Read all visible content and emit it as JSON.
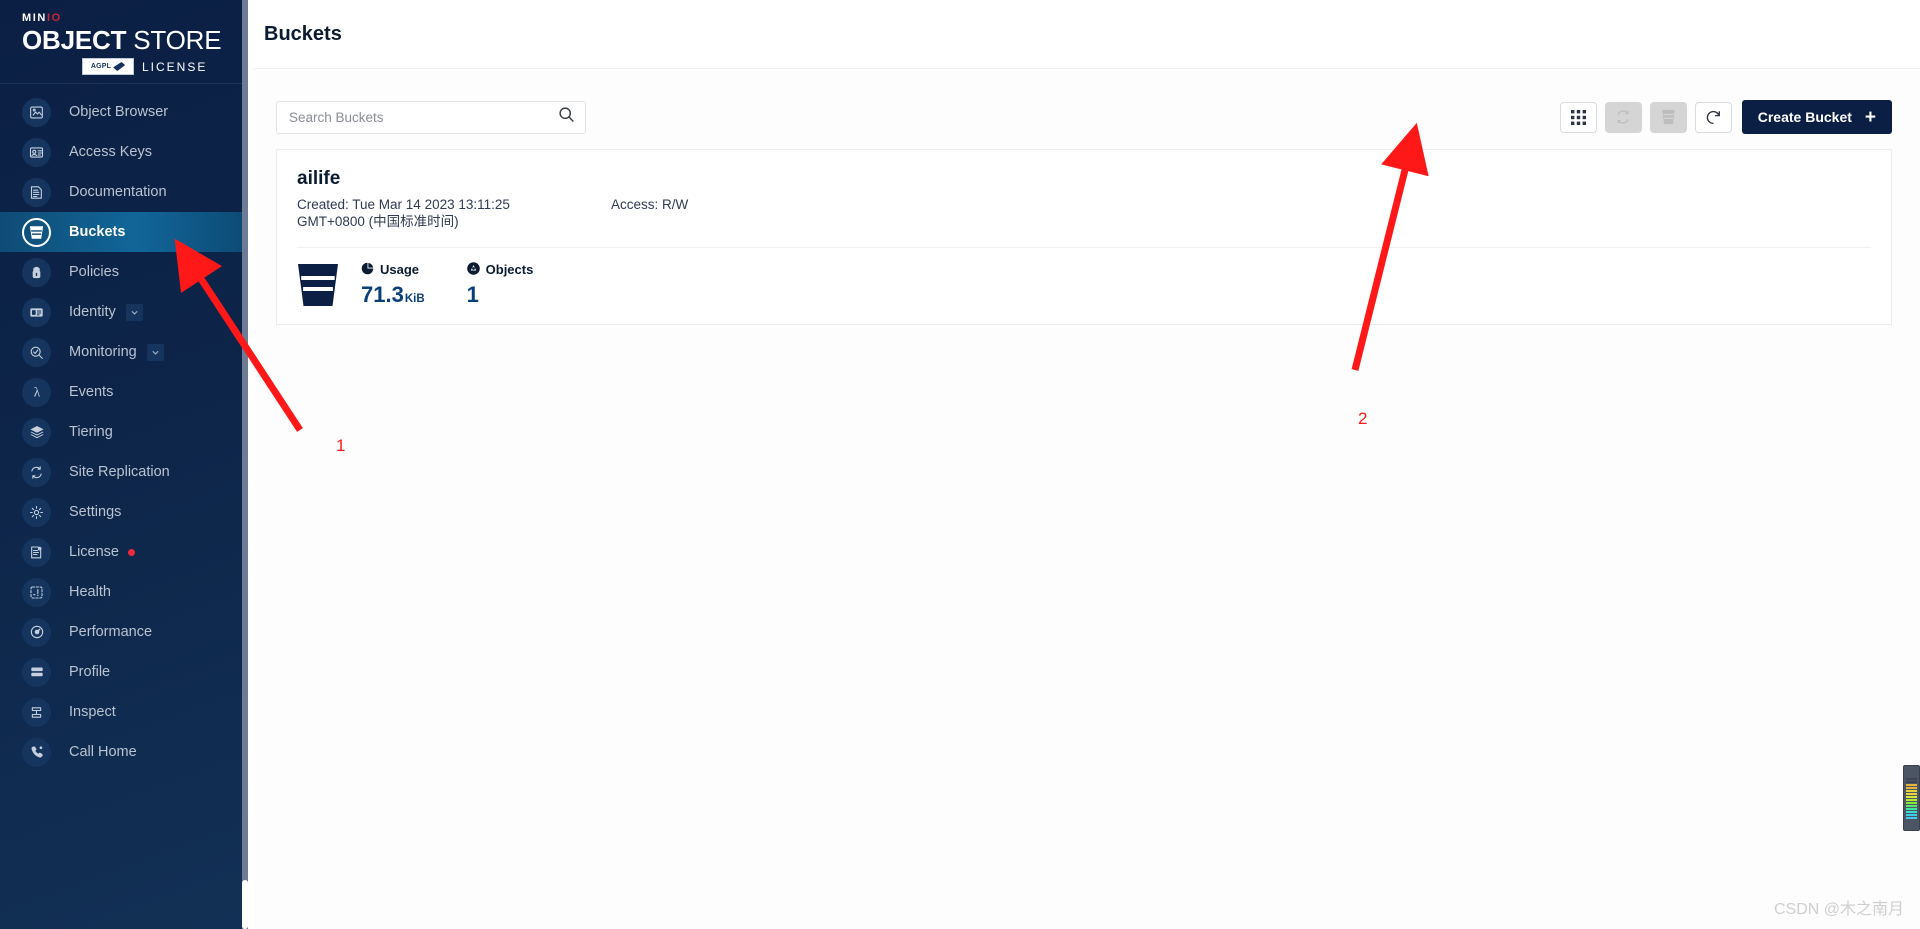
{
  "brand": {
    "line1_prefix": "MIN",
    "line1_suffix": "IO",
    "line2_bold": "OBJECT",
    "line2_thin": " STORE",
    "badge_text": "AGPL",
    "license_text": "LICENSE",
    "brand_red": "#c42a32",
    "sidebar_bg": "#0b1f44"
  },
  "sidebar": {
    "items": [
      {
        "label": "Object Browser",
        "icon": "object-browser-icon",
        "active": false
      },
      {
        "label": "Access Keys",
        "icon": "access-keys-icon",
        "active": false
      },
      {
        "label": "Documentation",
        "icon": "documentation-icon",
        "active": false
      },
      {
        "label": "Buckets",
        "icon": "bucket-icon",
        "active": true
      },
      {
        "label": "Policies",
        "icon": "policies-icon",
        "active": false
      },
      {
        "label": "Identity",
        "icon": "identity-icon",
        "active": false,
        "expandable": true
      },
      {
        "label": "Monitoring",
        "icon": "monitoring-icon",
        "active": false,
        "expandable": true
      },
      {
        "label": "Events",
        "icon": "lambda-icon",
        "active": false
      },
      {
        "label": "Tiering",
        "icon": "tiering-icon",
        "active": false
      },
      {
        "label": "Site Replication",
        "icon": "site-replication-icon",
        "active": false
      },
      {
        "label": "Settings",
        "icon": "gear-icon",
        "active": false
      },
      {
        "label": "License",
        "icon": "license-icon",
        "active": false,
        "badge_dot": true
      },
      {
        "label": "Health",
        "icon": "health-icon",
        "active": false
      },
      {
        "label": "Performance",
        "icon": "performance-icon",
        "active": false
      },
      {
        "label": "Profile",
        "icon": "profile-icon",
        "active": false
      },
      {
        "label": "Inspect",
        "icon": "inspect-icon",
        "active": false
      },
      {
        "label": "Call Home",
        "icon": "call-home-icon",
        "active": false
      }
    ]
  },
  "header": {
    "title": "Buckets"
  },
  "search": {
    "placeholder": "Search Buckets",
    "value": ""
  },
  "toolbar": {
    "buttons": [
      {
        "name": "grid-view-button",
        "icon": "grid-icon",
        "disabled": false
      },
      {
        "name": "replication-button",
        "icon": "replication-icon",
        "disabled": true
      },
      {
        "name": "delete-bucket-button",
        "icon": "trash-bucket-icon",
        "disabled": true
      },
      {
        "name": "refresh-button",
        "icon": "refresh-icon",
        "disabled": false
      }
    ],
    "create_bucket_label": "Create Bucket",
    "create_bucket_plus": "+",
    "create_bucket_color": "#0b1f44"
  },
  "bucket": {
    "name": "ailife",
    "created_label": "Created: Tue Mar 14 2023 13:11:25 GMT+0800 (中国标准时间)",
    "access_label": "Access: R/W",
    "usage_label": "Usage",
    "usage_value": "71.3",
    "usage_unit": "KiB",
    "objects_label": "Objects",
    "objects_value": "1",
    "value_color": "#0b3f78"
  },
  "annotations": {
    "color": "#ff1818",
    "items": [
      {
        "number": "1",
        "target": "sidebar-item-buckets"
      },
      {
        "number": "2",
        "target": "create-bucket-button"
      }
    ]
  },
  "watermark": {
    "text": "CSDN @木之南月"
  },
  "edge_widget": {
    "bar_colors": [
      "#3d4553",
      "#3d4553",
      "#e8b43a",
      "#e8b43a",
      "#e8d23a",
      "#e8d23a",
      "#d7e83a",
      "#b8e83a",
      "#8ae83a",
      "#5ce86a",
      "#3ae8a0",
      "#3ae0d8",
      "#3ad0e8",
      "#45c8ee"
    ]
  }
}
